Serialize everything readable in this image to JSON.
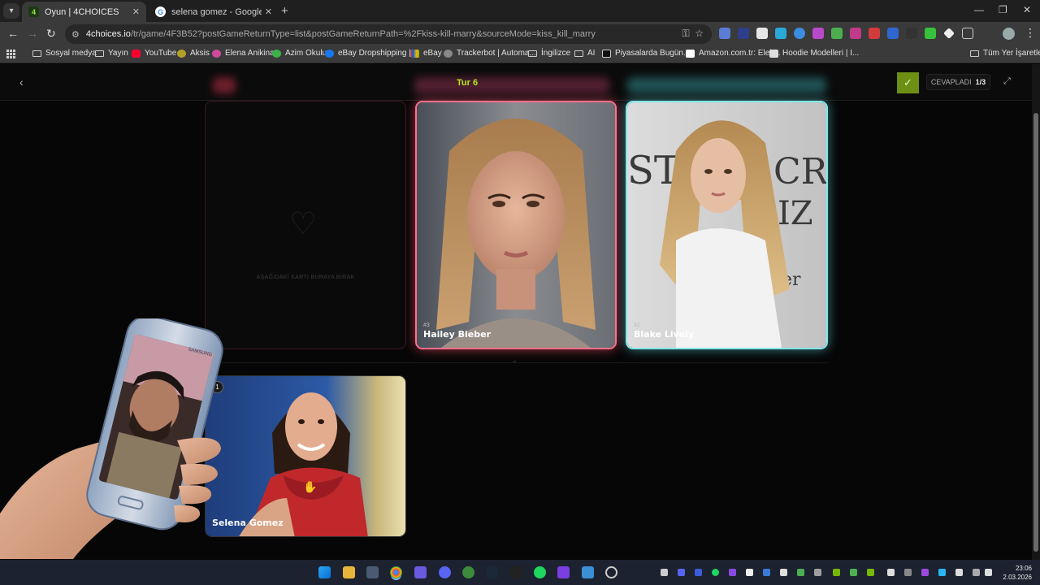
{
  "browser": {
    "tabs": [
      {
        "title": "Oyun | 4CHOICES",
        "favicon": "4"
      },
      {
        "title": "selena gomez - Google'da Ara",
        "favicon": "G"
      }
    ],
    "url_host": "4choices.io",
    "url_path": "/tr/game/4F3B52?postGameReturnType=list&postGameReturnPath=%2Fkiss-kill-marry&sourceMode=kiss_kill_marry",
    "bookmarks": [
      {
        "label": "Sosyal medya",
        "icon": "folder-icon"
      },
      {
        "label": "Yayın",
        "icon": "folder-icon"
      },
      {
        "label": "YouTube",
        "icon": "youtube-icon",
        "color": "#ff0033"
      },
      {
        "label": "Aksis",
        "icon": "aksis-icon",
        "color": "#b3a02a"
      },
      {
        "label": "Elena Anikina",
        "icon": "site-icon",
        "color": "#d04a9c"
      },
      {
        "label": "Azim Okulu",
        "icon": "site-icon",
        "color": "#3bb34a"
      },
      {
        "label": "eBay Dropshipping |...",
        "icon": "facebook-icon",
        "color": "#1877f2"
      },
      {
        "label": "eBay",
        "icon": "ebay-icon",
        "color": "#e53238"
      },
      {
        "label": "Trackerbot | Automa...",
        "icon": "site-icon",
        "color": "#888888"
      },
      {
        "label": "İngilizce",
        "icon": "folder-icon"
      },
      {
        "label": "AI",
        "icon": "folder-icon"
      },
      {
        "label": "Piyasalarda Bugün...",
        "icon": "tv-icon",
        "color": "#111111"
      },
      {
        "label": "Amazon.com.tr: Elek...",
        "icon": "amazon-icon",
        "color": "#ffffff"
      },
      {
        "label": "Hoodie Modelleri | I...",
        "icon": "site-icon",
        "color": "#dddddd"
      }
    ],
    "all_bookmarks": "Tüm Yer İşaretleri"
  },
  "game": {
    "round": "Tur 6",
    "answered_label": "CEVAPLADI",
    "answered_count": "1/3",
    "drop_hint": "AŞAĞIDAKİ KARTI BURAYA BIRAK",
    "cards": [
      {
        "number": "#3",
        "name": "Hailey Bieber"
      },
      {
        "number": "#2",
        "name": "Blake Lively"
      }
    ],
    "pending_card": {
      "badge": "1",
      "name": "Selena Gomez"
    },
    "accent": "#b5e61d"
  },
  "phone_overlay": {
    "brand": "SAMSUNG"
  },
  "taskbar": {
    "time": "23:06",
    "date": "2.03.2026"
  }
}
